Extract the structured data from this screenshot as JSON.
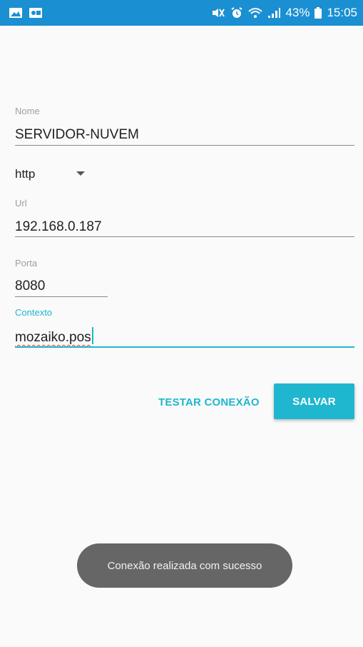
{
  "status_bar": {
    "left_icons": [
      "image-icon",
      "photo-app-icon"
    ],
    "right_icons": [
      "mute-vibrate-icon",
      "alarm-icon",
      "wifi-icon",
      "signal-icon",
      "battery-icon"
    ],
    "battery_text": "43%",
    "time": "15:05",
    "color": "#1a8fd2"
  },
  "form": {
    "nome": {
      "label": "Nome",
      "value": "SERVIDOR-NUVEM"
    },
    "protocol": {
      "selected": "http"
    },
    "url": {
      "label": "Url",
      "value": "192.168.0.187"
    },
    "porta": {
      "label": "Porta",
      "value": "8080"
    },
    "contexto": {
      "label": "Contexto",
      "value": "mozaiko.pos",
      "focused": true
    }
  },
  "actions": {
    "test_label": "TESTAR CONEXÃO",
    "save_label": "SALVAR",
    "accent": "#1fb6cf"
  },
  "toast": {
    "message": "Conexão realizada com sucesso"
  }
}
